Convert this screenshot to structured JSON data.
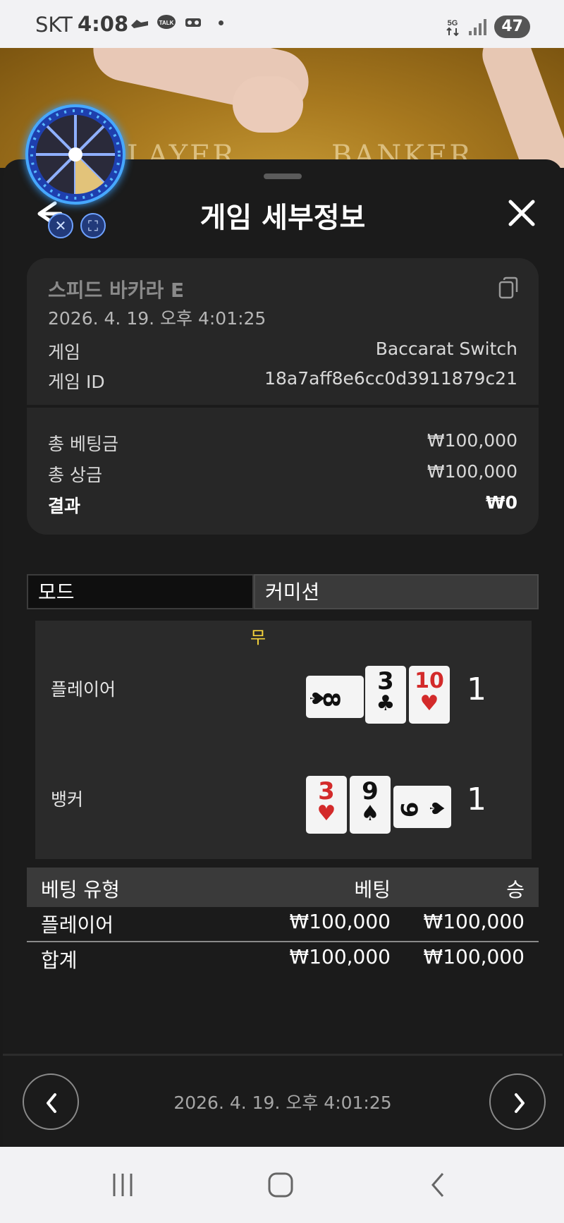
{
  "status_bar": {
    "carrier": "SKT",
    "time": "4:08",
    "network": "5G",
    "battery": "47"
  },
  "video": {
    "left_text": "PLAYER",
    "right_text": "BANKER"
  },
  "sheet": {
    "title": "게임 세부정보"
  },
  "game_info": {
    "name": "스피드 바카라 E",
    "datetime": "2026. 4. 19. 오후 4:01:25",
    "game_label": "게임",
    "game_value": "Baccarat Switch",
    "id_label": "게임 ID",
    "id_value": "18a7aff8e6cc0d3911879c21",
    "total_bet_label": "총 베팅금",
    "total_bet_value": "₩100,000",
    "total_prize_label": "총 상금",
    "total_prize_value": "₩100,000",
    "result_label": "결과",
    "result_value": "₩0"
  },
  "tabs": [
    {
      "label": "모드",
      "active": true
    },
    {
      "label": "커미션",
      "active": false
    }
  ],
  "hand": {
    "result": "무",
    "player": {
      "label": "플레이어",
      "score": "1",
      "cards": [
        {
          "rank": "8",
          "suit": "♠",
          "color": "black",
          "rotated": true
        },
        {
          "rank": "3",
          "suit": "♣",
          "color": "black",
          "rotated": false
        },
        {
          "rank": "10",
          "suit": "♥",
          "color": "red",
          "rotated": false
        }
      ]
    },
    "banker": {
      "label": "뱅커",
      "score": "1",
      "cards": [
        {
          "rank": "3",
          "suit": "♥",
          "color": "red",
          "rotated": false
        },
        {
          "rank": "9",
          "suit": "♠",
          "color": "black",
          "rotated": false
        },
        {
          "rank": "9",
          "suit": "♠",
          "color": "black",
          "rotated": true
        }
      ]
    }
  },
  "bets": {
    "headers": [
      "베팅 유형",
      "베팅",
      "승"
    ],
    "rows": [
      {
        "type": "플레이어",
        "bet": "₩100,000",
        "win": "₩100,000"
      }
    ],
    "total": {
      "type": "합계",
      "bet": "₩100,000",
      "win": "₩100,000"
    }
  },
  "footer": {
    "datetime": "2026. 4. 19. 오후 4:01:25"
  },
  "colors": {
    "result_yellow": "#f4d23b",
    "card_red": "#d32a2a",
    "sheet_bg": "#1b1b1b"
  }
}
